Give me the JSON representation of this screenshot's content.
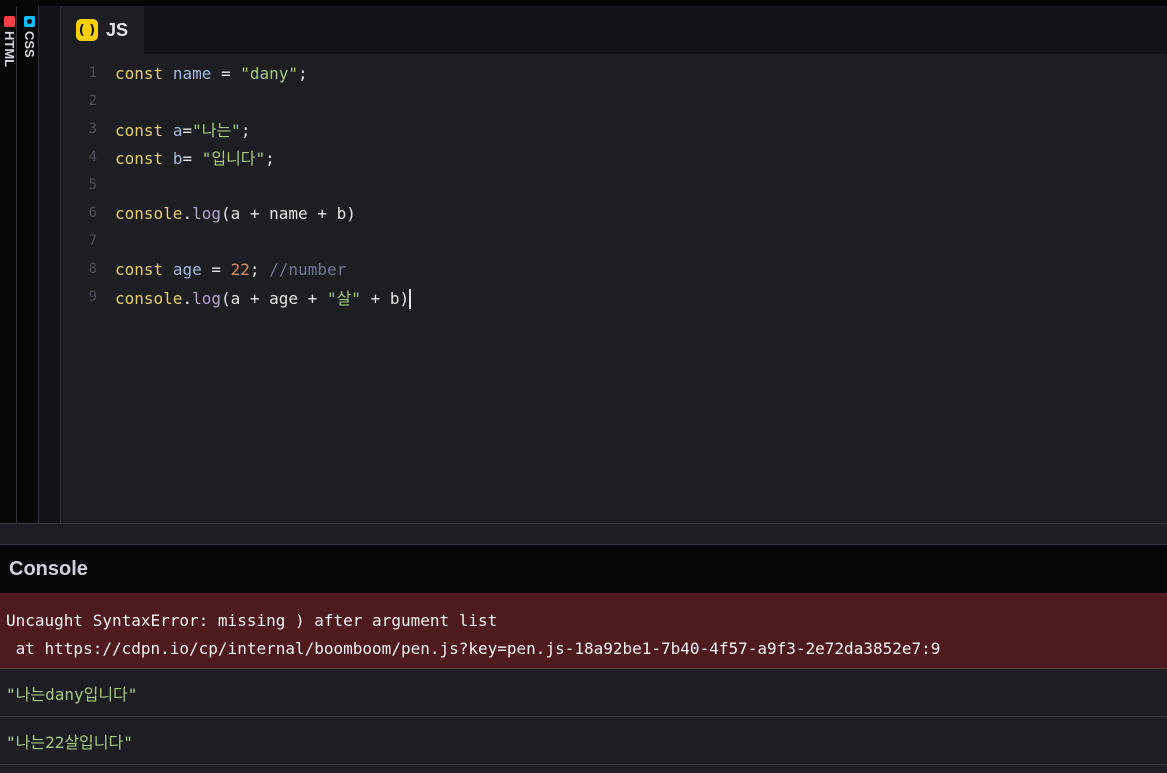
{
  "side_tabs": [
    {
      "label": "HTML",
      "icon": "html-icon",
      "color": "#ff3c41"
    },
    {
      "label": "CSS",
      "icon": "css-icon",
      "color": "#0ebeff"
    }
  ],
  "editor": {
    "tab_label": "JS",
    "tab_icon_glyph": "( )",
    "lines": [
      {
        "num": "1",
        "tokens": [
          {
            "t": "const",
            "c": "kw"
          },
          {
            "t": " "
          },
          {
            "t": "name",
            "c": "var"
          },
          {
            "t": " = "
          },
          {
            "t": "\"dany\"",
            "c": "str"
          },
          {
            "t": ";"
          }
        ]
      },
      {
        "num": "2",
        "tokens": []
      },
      {
        "num": "3",
        "tokens": [
          {
            "t": "const",
            "c": "kw"
          },
          {
            "t": " "
          },
          {
            "t": "a",
            "c": "var"
          },
          {
            "t": "="
          },
          {
            "t": "\"나는\"",
            "c": "str"
          },
          {
            "t": ";"
          }
        ]
      },
      {
        "num": "4",
        "tokens": [
          {
            "t": "const",
            "c": "kw"
          },
          {
            "t": " "
          },
          {
            "t": "b",
            "c": "var"
          },
          {
            "t": "= "
          },
          {
            "t": "\"입니다\"",
            "c": "str"
          },
          {
            "t": ";"
          }
        ]
      },
      {
        "num": "5",
        "tokens": []
      },
      {
        "num": "6",
        "tokens": [
          {
            "t": "console",
            "c": "kw"
          },
          {
            "t": "."
          },
          {
            "t": "log",
            "c": "fn"
          },
          {
            "t": "(a + name + b)"
          }
        ]
      },
      {
        "num": "7",
        "tokens": []
      },
      {
        "num": "8",
        "tokens": [
          {
            "t": "const",
            "c": "kw"
          },
          {
            "t": " "
          },
          {
            "t": "age",
            "c": "var"
          },
          {
            "t": " = "
          },
          {
            "t": "22",
            "c": "num"
          },
          {
            "t": "; "
          },
          {
            "t": "//number",
            "c": "cmt"
          }
        ]
      },
      {
        "num": "9",
        "tokens": [
          {
            "t": "console",
            "c": "kw"
          },
          {
            "t": "."
          },
          {
            "t": "log",
            "c": "fn"
          },
          {
            "t": "(a + age + "
          },
          {
            "t": "\"살\"",
            "c": "str"
          },
          {
            "t": " + b)"
          }
        ],
        "caret": true
      }
    ]
  },
  "console": {
    "title": "Console",
    "error_lines": [
      "Uncaught SyntaxError: missing ) after argument list",
      " at https://cdpn.io/cp/internal/boomboom/pen.js?key=pen.js-18a92be1-7b40-4f57-a9f3-2e72da3852e7:9"
    ],
    "logs": [
      "\"나는dany입니다\"",
      "\"나는22살입니다\""
    ]
  }
}
